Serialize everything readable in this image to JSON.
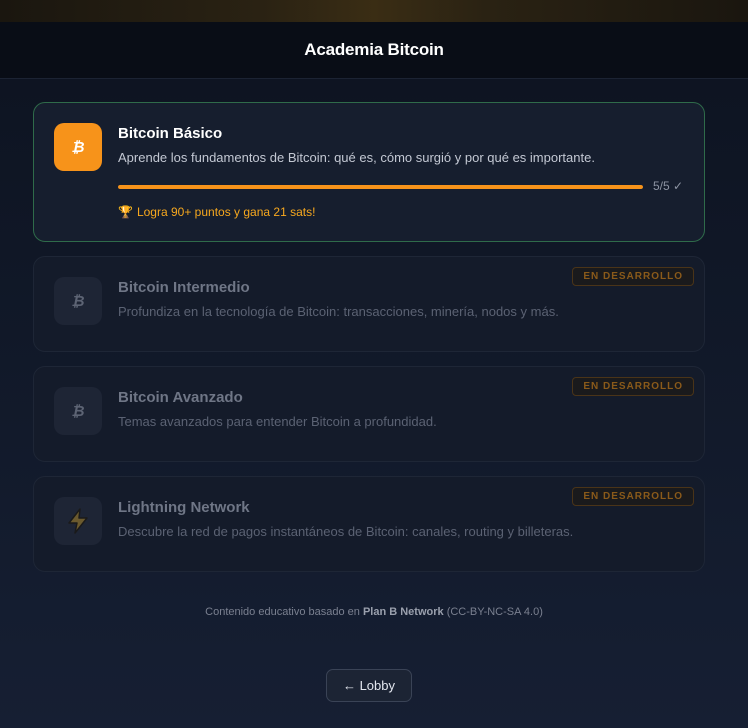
{
  "header": {
    "title": "Academia Bitcoin"
  },
  "courses": [
    {
      "title": "Bitcoin Básico",
      "description": "Aprende los fundamentos de Bitcoin: qué es, cómo surgió y por qué es importante.",
      "icon": "bitcoin-icon",
      "progress": {
        "completed": 5,
        "total": 5,
        "fraction": 1.0,
        "label": "5/5 ✓"
      },
      "reward": "Logra 90+ puntos y gana 21 sats!",
      "status": "active"
    },
    {
      "title": "Bitcoin Intermedio",
      "description": "Profundiza en la tecnología de Bitcoin: transacciones, minería, nodos y más.",
      "icon": "bitcoin-icon",
      "badge": "EN DESARROLLO",
      "status": "locked"
    },
    {
      "title": "Bitcoin Avanzado",
      "description": "Temas avanzados para entender Bitcoin a profundidad.",
      "icon": "bitcoin-icon",
      "badge": "EN DESARROLLO",
      "status": "locked"
    },
    {
      "title": "Lightning Network",
      "description": "Descubre la red de pagos instantáneos de Bitcoin: canales, routing y billeteras.",
      "icon": "lightning-icon",
      "badge": "EN DESARROLLO",
      "status": "locked"
    }
  ],
  "footer": {
    "prefix": "Contenido educativo basado en",
    "source": "Plan B Network",
    "license": "(CC-BY-NC-SA 4.0)"
  },
  "lobby_button": {
    "label": "← Lobby"
  },
  "colors": {
    "accent": "#f7931a",
    "active_border": "#2f6b4a",
    "badge_text": "#8a5a1a"
  }
}
